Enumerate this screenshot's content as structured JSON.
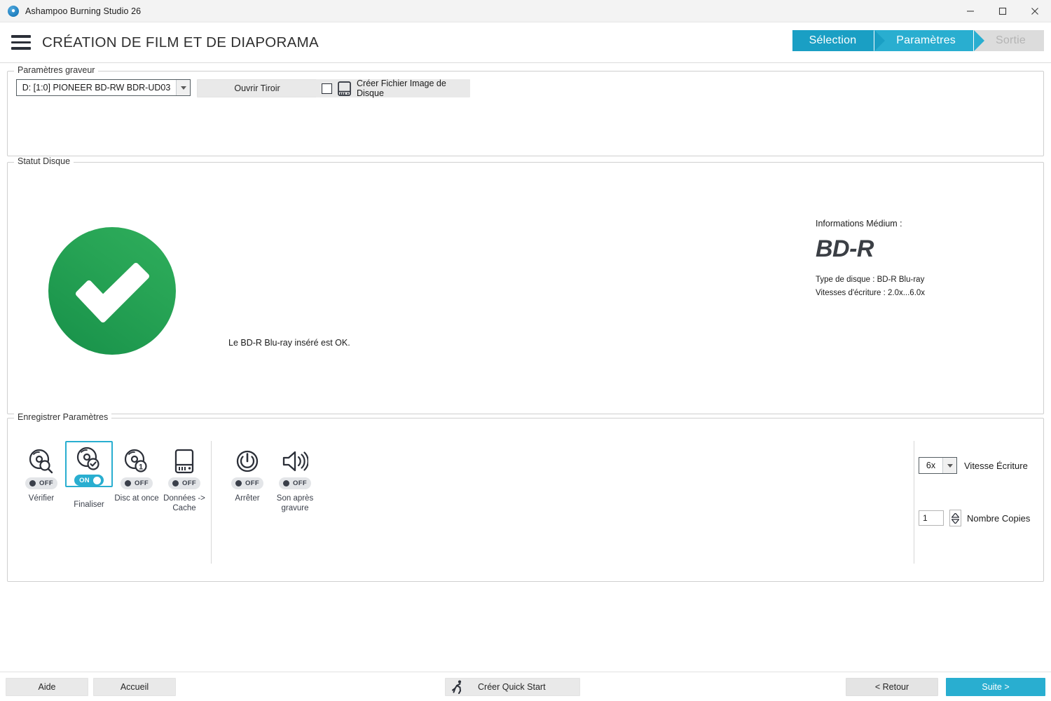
{
  "window": {
    "title": "Ashampoo Burning Studio 26",
    "app_icon": "flame-icon",
    "minimize_icon": "minimize-icon",
    "maximize_icon": "maximize-icon",
    "close_icon": "close-icon"
  },
  "header": {
    "menu_icon": "hamburger-menu-icon",
    "page_title": "CRÉATION DE FILM ET DE DIAPORAMA"
  },
  "steps": [
    {
      "label": "Sélection",
      "state": "done",
      "color": "#1a9fc4"
    },
    {
      "label": "Paramètres",
      "state": "active",
      "color": "#29aed0"
    },
    {
      "label": "Sortie",
      "state": "upcoming",
      "color": "#dcdcdc"
    }
  ],
  "burner_settings": {
    "legend": "Paramètres graveur",
    "drive_select": {
      "value": "D: [1:0] PIONEER BD-RW   BDR-UD03",
      "arrow_icon": "chevron-down-icon"
    },
    "open_tray_button": "Ouvrir Tiroir",
    "disc_image": {
      "checkbox_checked": false,
      "icon": "disc-image-file-icon",
      "label": "Créer Fichier Image de Disque"
    }
  },
  "disc_status": {
    "legend": "Statut Disque",
    "status_icon": "green-check-circle-icon",
    "status_message": "Le BD-R Blu-ray inséré est OK.",
    "media_info_heading": "Informations Médium :",
    "media_type": "BD-R",
    "disc_type_line": "Type de disque : BD-R Blu-ray",
    "write_speeds_line": "Vitesses d'écriture : 2.0x...6.0x"
  },
  "record_settings": {
    "legend": "Enregistrer Paramètres",
    "options": [
      {
        "label": "Vérifier",
        "state": "OFF",
        "selected": false,
        "icon": "disc-verify-icon"
      },
      {
        "label": "Finaliser",
        "state": "ON",
        "selected": true,
        "icon": "disc-finalize-icon"
      },
      {
        "label": "Disc at once",
        "state": "OFF",
        "selected": false,
        "icon": "disc-at-once-icon"
      },
      {
        "label": "Données -> Cache",
        "state": "OFF",
        "selected": false,
        "icon": "hard-drive-cache-icon"
      },
      {
        "label": "Arrêter",
        "state": "OFF",
        "selected": false,
        "icon": "power-off-icon"
      },
      {
        "label": "Son après gravure",
        "state": "OFF",
        "selected": false,
        "icon": "speaker-sound-icon"
      }
    ],
    "write_speed": {
      "value": "6x",
      "label": "Vitesse Écriture",
      "arrow_icon": "chevron-down-icon"
    },
    "copies": {
      "value": "1",
      "label": "Nombre Copies",
      "spinner_icon": "spinner-up-down-icon"
    }
  },
  "footer": {
    "help_button": "Aide",
    "home_button": "Accueil",
    "quick_start_button": "Créer Quick Start",
    "quick_start_icon": "runner-icon",
    "back_button": "< Retour",
    "next_button": "Suite >"
  },
  "colors": {
    "accent": "#29aed0",
    "accent_dark": "#1a9fc4",
    "success": "#27a455",
    "inactive": "#dcdcdc"
  }
}
